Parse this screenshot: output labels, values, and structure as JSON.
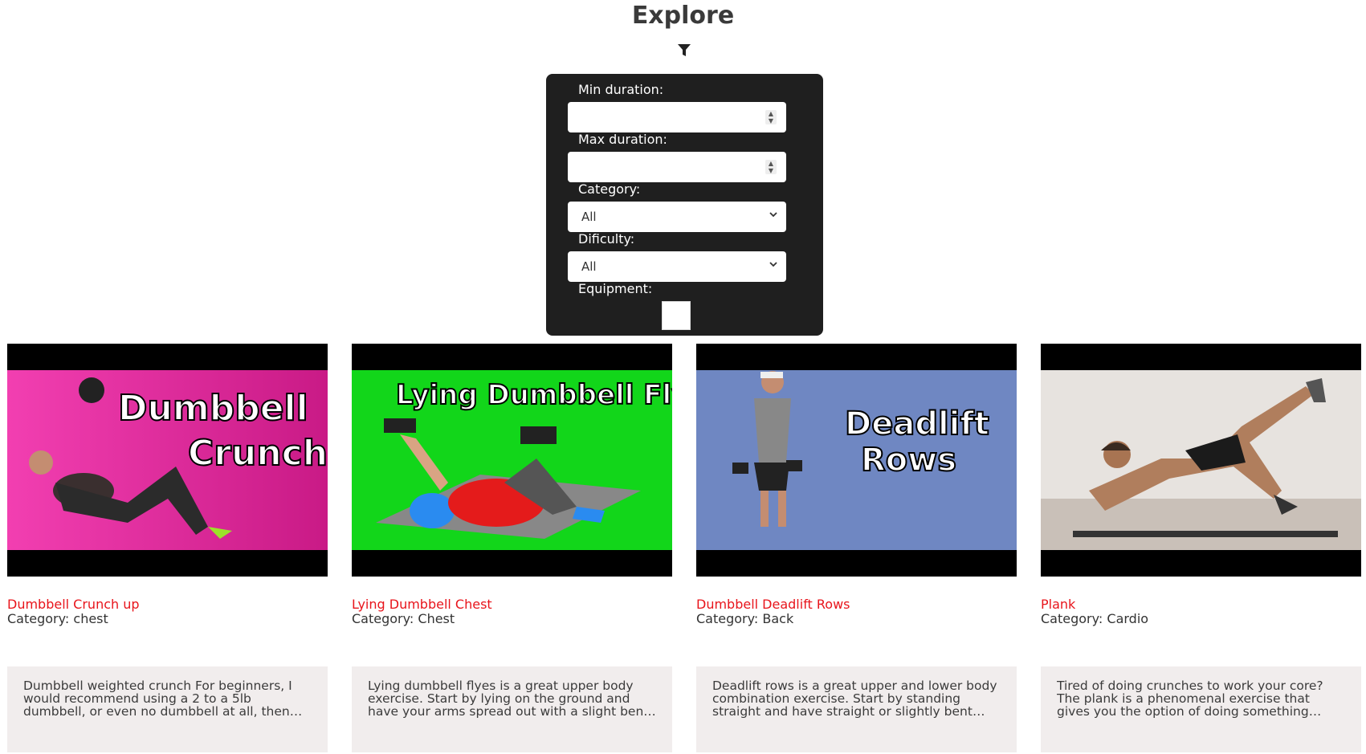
{
  "page": {
    "title": "Explore"
  },
  "filter": {
    "icon": "filter-icon",
    "min_duration_label": "Min duration:",
    "max_duration_label": "Max duration:",
    "category_label": "Category:",
    "category_value": "All",
    "difficulty_label": "Dificulty:",
    "difficulty_value": "All",
    "equipment_label": "Equipment:"
  },
  "exercises": [
    {
      "thumb_text": [
        "Dumbbell",
        "Crunches"
      ],
      "title": "Dumbbell Crunch up",
      "category": "Category: chest",
      "description": "Dumbbell weighted crunch For beginners, I would recommend using a 2 to a 5lb dumbbell, or even no dumbbell at all, then work your way up as you get stronger."
    },
    {
      "thumb_text": [
        "Lying Dumbbell Flyes"
      ],
      "title": "Lying Dumbbell Chest",
      "category": "Category: Chest",
      "description": "Lying dumbbell flyes is a great upper body exercise. Start by lying on the ground and have your arms spread out with a slight bend in your elbows."
    },
    {
      "thumb_text": [
        "Deadlift",
        "Rows"
      ],
      "title": "Dumbbell Deadlift Rows",
      "category": "Category: Back",
      "description": "Deadlift rows is a great upper and lower body combination exercise. Start by standing straight and have straight or slightly bent knees."
    },
    {
      "thumb_text": [],
      "title": "Plank",
      "category": "Category: Cardio",
      "description": "Tired of doing crunches to work your core? The plank is a phenomenal exercise that gives you the option of doing something different for your abs."
    }
  ],
  "colors": {
    "panel": "#1f1f1f",
    "title_red": "#e8141b",
    "desc_bg": "#f1eded"
  }
}
